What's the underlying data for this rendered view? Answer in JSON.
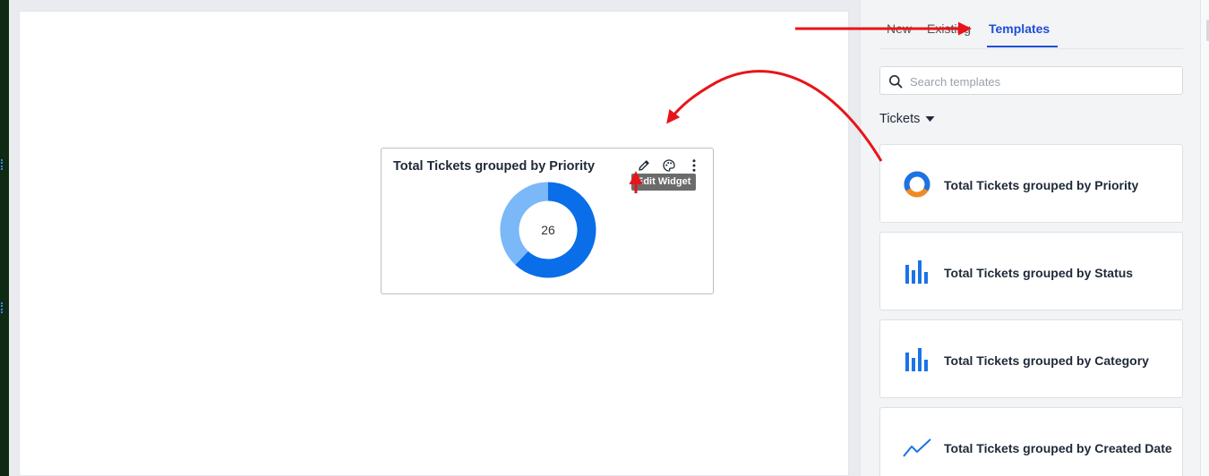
{
  "widget": {
    "title": "Total Tickets grouped by Priority",
    "total": "26",
    "tooltip": "Edit Widget",
    "donut": {
      "segments": [
        {
          "fraction": 0.62,
          "color": "#0a6ee8"
        },
        {
          "fraction": 0.38,
          "color": "#7ab8f8"
        }
      ]
    }
  },
  "panel": {
    "tabs": [
      {
        "label": "New"
      },
      {
        "label": "Existing"
      },
      {
        "label": "Templates",
        "active": true
      }
    ],
    "search_placeholder": "Search templates",
    "category": "Tickets",
    "templates": [
      {
        "label": "Total Tickets grouped by Priority",
        "icon": "donut-chart-icon"
      },
      {
        "label": "Total Tickets grouped by Status",
        "icon": "bar-chart-icon"
      },
      {
        "label": "Total Tickets grouped by Category",
        "icon": "bar-chart-icon"
      },
      {
        "label": "Total Tickets grouped by Created Date",
        "icon": "line-chart-icon"
      }
    ]
  },
  "colors": {
    "accent": "#1d4ed8",
    "annotation": "#e8141a"
  }
}
